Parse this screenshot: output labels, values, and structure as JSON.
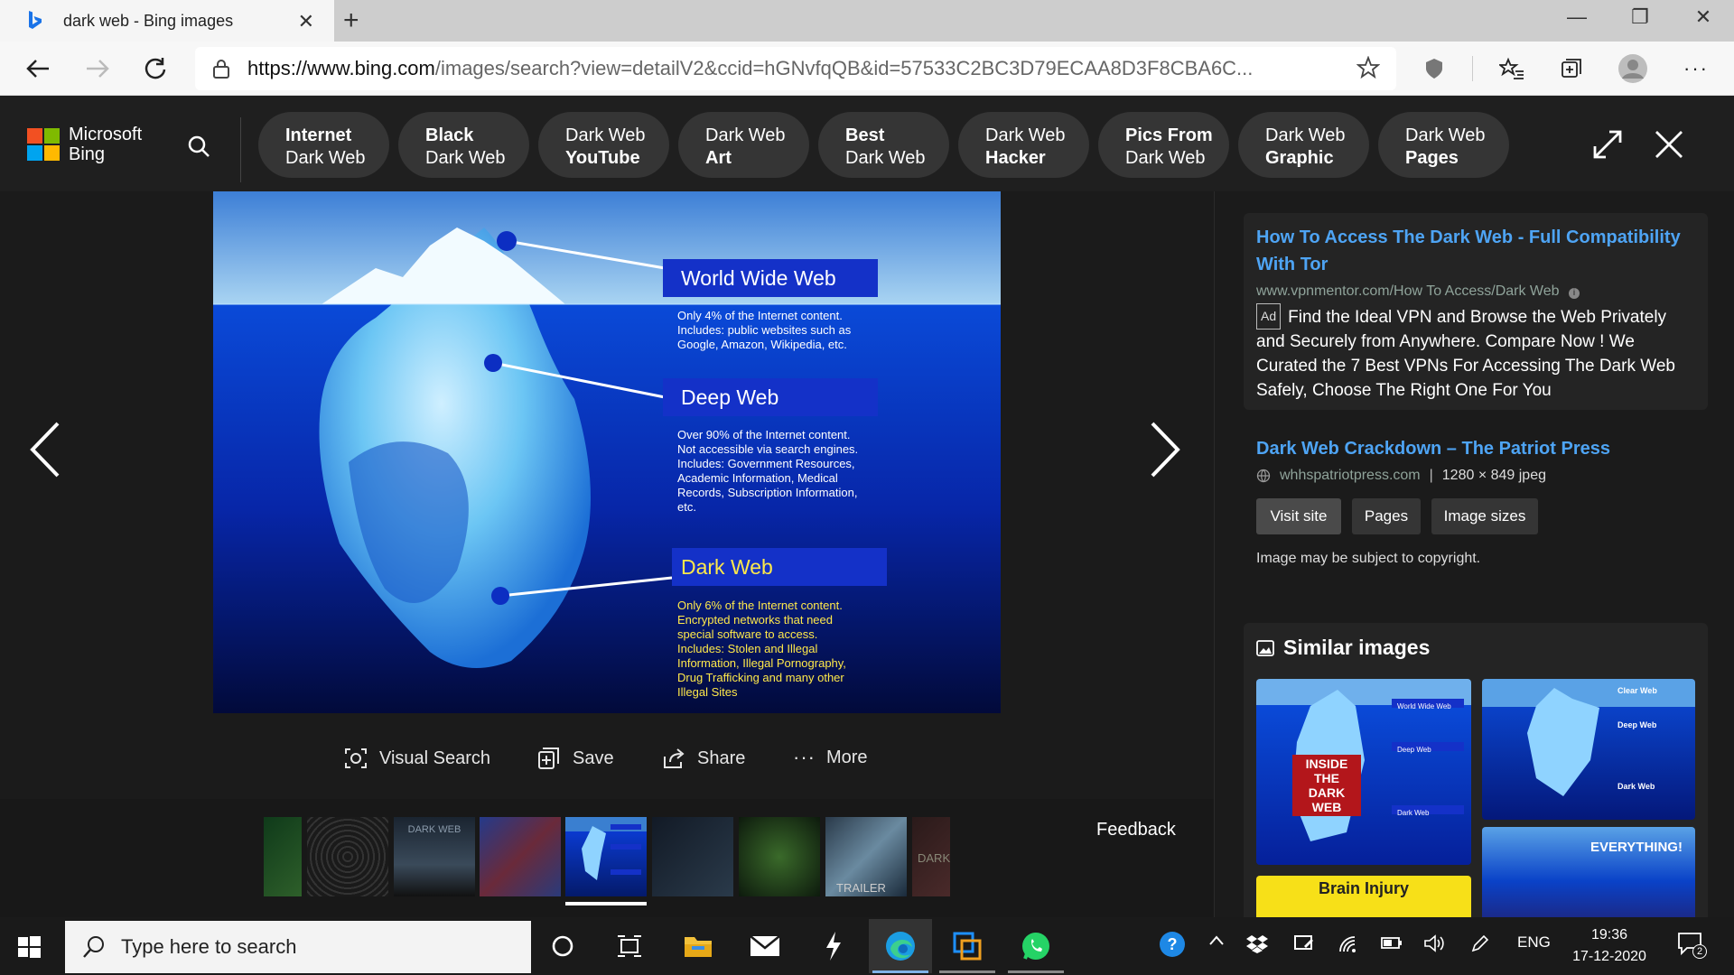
{
  "browser": {
    "tab_title": "dark web - Bing images",
    "url_host": "https://www.bing.com",
    "url_path": "/images/search?view=detailV2&ccid=hGNvfqQB&id=57533C2BC3D79ECAA8D3F8CBA6C..."
  },
  "bing": {
    "logo_line1": "Microsoft",
    "logo_line2": "Bing",
    "chips": [
      {
        "l1": "Internet",
        "l2": "Dark Web"
      },
      {
        "l1": "Black",
        "l2": "Dark Web"
      },
      {
        "l1": "Dark Web",
        "l2": "YouTube"
      },
      {
        "l1": "Dark Web",
        "l2": "Art"
      },
      {
        "l1": "Best",
        "l2": "Dark Web"
      },
      {
        "l1": "Dark Web",
        "l2": "Hacker"
      },
      {
        "l1": "Pics From",
        "l2": "Dark Web"
      },
      {
        "l1": "Dark Web",
        "l2": "Graphic"
      },
      {
        "l1": "Dark Web",
        "l2": "Pages"
      }
    ]
  },
  "image": {
    "www_title": "World Wide Web",
    "www_text": [
      "Only 4% of the Internet content.",
      "Includes: public websites such as",
      "Google, Amazon, Wikipedia, etc."
    ],
    "deep_title": "Deep Web",
    "deep_text": [
      "Over 90% of the Internet content.",
      "Not accessible via search engines.",
      "Includes: Government Resources,",
      "Academic Information, Medical",
      "Records, Subscription Information,",
      "etc."
    ],
    "dark_title": "Dark Web",
    "dark_text": [
      "Only 6% of the Internet content.",
      "Encrypted networks that need",
      "special software to access.",
      "Includes: Stolen and Illegal",
      "Information, Illegal Pornography,",
      "Drug Trafficking and many other",
      "Illegal Sites"
    ]
  },
  "actions": {
    "visual_search": "Visual Search",
    "save": "Save",
    "share": "Share",
    "more": "More"
  },
  "filmstrip": {
    "feedback": "Feedback",
    "thumb_labels": [
      "DARK WEB",
      "TRAILER",
      "DARK"
    ]
  },
  "ad": {
    "title": "How To Access The Dark Web - Full Compatibility With Tor",
    "url": "www.vpnmentor.com/How To Access/Dark Web",
    "badge": "Ad",
    "text": "Find the Ideal VPN and Browse the Web Privately and Securely from Anywhere. Compare Now ! We Curated the 7 Best VPNs For Accessing The Dark Web Safely, Choose The Right One For You"
  },
  "source": {
    "title": "Dark Web Crackdown – The Patriot Press",
    "domain": "whhspatriotpress.com",
    "meta": "1280 × 849 jpeg",
    "separator": "|",
    "buttons": [
      "Visit site",
      "Pages",
      "Image sizes"
    ],
    "copyright": "Image may be subject to copyright."
  },
  "similar": {
    "heading": "Similar images",
    "thumb1_banner": "INSIDE THE DARK WEB",
    "thumb1_labels": [
      "World Wide Web",
      "Deep Web",
      "Dark Web"
    ],
    "thumb2_labels": [
      "Clear Web",
      "Deep Web",
      "Dark Web"
    ],
    "thumb3_caption": "Brain Injury",
    "thumb4_caption": "EVERYTHING!"
  },
  "taskbar": {
    "search_placeholder": "Type here to search",
    "language": "ENG",
    "time": "19:36",
    "date": "17-12-2020",
    "notification_count": "2"
  },
  "colors": {
    "bing_link": "#4ea4f4",
    "header_bg": "#1f1f1f",
    "chip_bg": "#353535",
    "page_bg": "#1b1b1b"
  }
}
